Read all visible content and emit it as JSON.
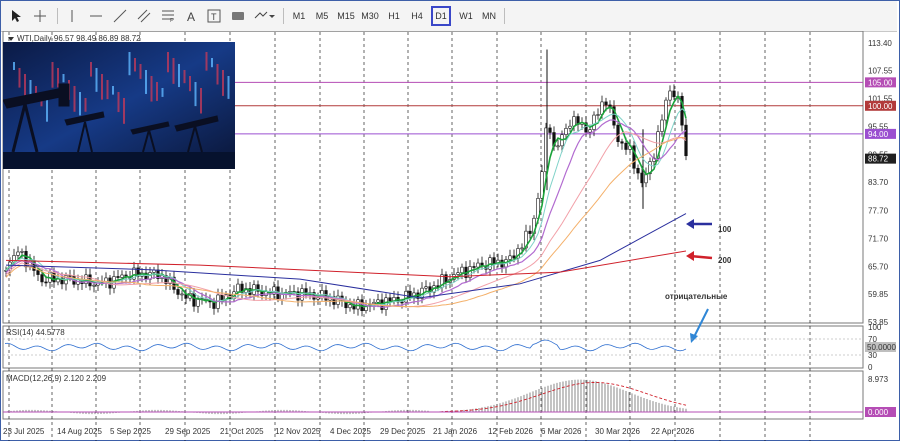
{
  "toolbar": {
    "timeframes": [
      "M1",
      "M5",
      "M15",
      "M30",
      "H1",
      "H4",
      "D1",
      "W1",
      "MN"
    ],
    "selected_timeframe": "D1"
  },
  "symbol_info": "WTI,Daily  96.57 98.49 86.89 88.72",
  "price_axis": [
    "113.40",
    "107.55",
    "101.55",
    "95.55",
    "89.55",
    "83.70",
    "77.70",
    "71.70",
    "65.70",
    "59.85",
    "53.85"
  ],
  "level_tags": [
    {
      "label": "105.00",
      "color": "#b54db5"
    },
    {
      "label": "100.00",
      "color": "#b23a3a"
    },
    {
      "label": "94.00",
      "color": "#9b4fd0"
    },
    {
      "label": "88.72",
      "color": "#202020"
    }
  ],
  "annotations": {
    "ma100": "100",
    "ma200": "200",
    "negative": "отрицательные",
    "ma100_color": "#2a2f9e",
    "ma200_color": "#d0212b",
    "negative_color": "#2f86d6"
  },
  "rsi": {
    "label": "RSI(14) 44.5778",
    "axis": [
      "100",
      "70",
      "30",
      "0"
    ],
    "tag": "50.0000"
  },
  "macd": {
    "label": "MACD(12,26,9) 2.120 2.209",
    "axis": [
      "8.973"
    ],
    "tag": "0.000"
  },
  "dates": [
    "23 Jul 2025",
    "14 Aug 2025",
    "5 Sep 2025",
    "29 Sep 2025",
    "21 Oct 2025",
    "12 Nov 2025",
    "4 Dec 2025",
    "29 Dec 2025",
    "21 Jan 2026",
    "12 Feb 2026",
    "6 Mar 2026",
    "30 Mar 2026",
    "22 Apr 2026"
  ]
}
